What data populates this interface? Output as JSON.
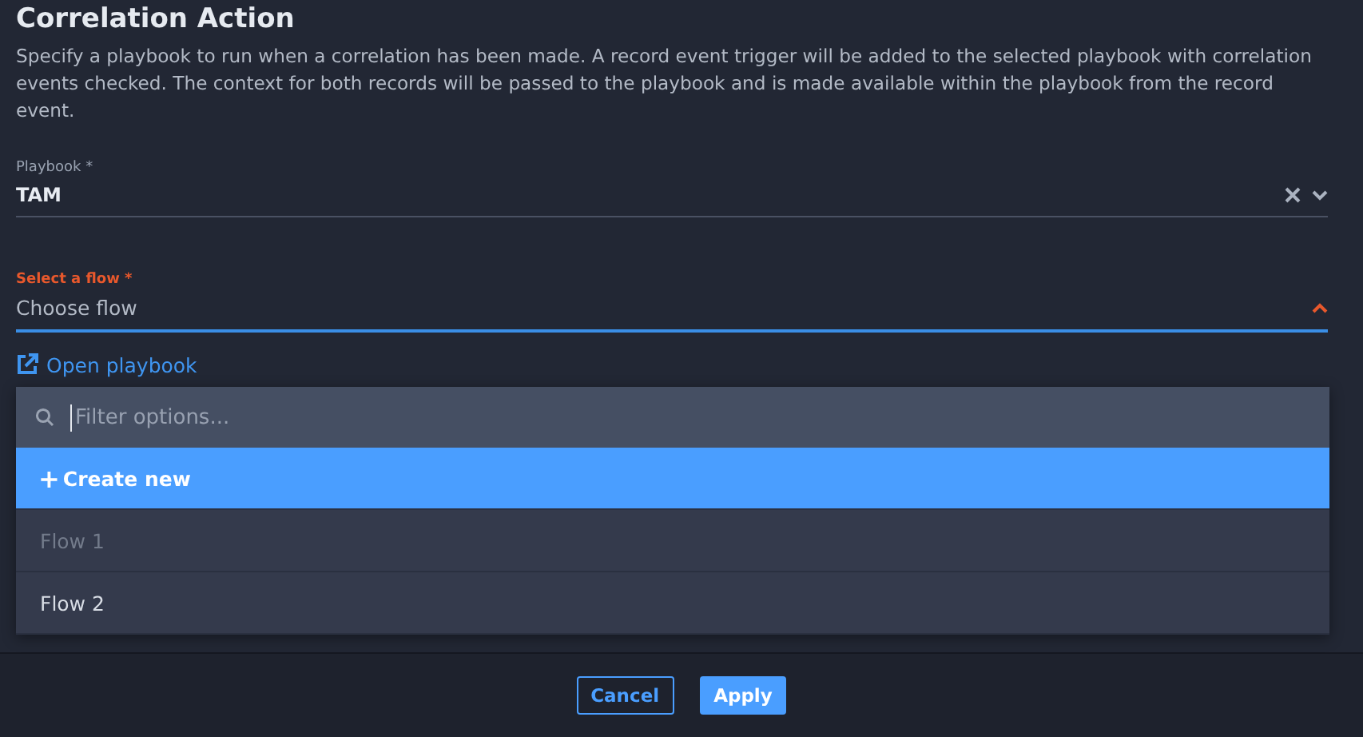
{
  "title": "Correlation Action",
  "description": "Specify a playbook to run when a correlation has been made. A record event trigger will be added to the selected playbook with correlation events checked. The context for both records will be passed to the playbook and is made available within the playbook from the record event.",
  "playbook_field": {
    "label": "Playbook *",
    "value": "TAM",
    "clearable": true
  },
  "flow_field": {
    "label": "Select a flow *",
    "placeholder": "Choose flow",
    "open": true,
    "invalid": true
  },
  "link": {
    "label": "Open playbook"
  },
  "dropdown": {
    "filter_placeholder": "Filter options...",
    "create": {
      "icon": "+",
      "label": "Create new",
      "highlighted": true
    },
    "options": [
      {
        "label": "Flow 1",
        "disabled": true
      },
      {
        "label": "Flow 2",
        "disabled": false
      }
    ]
  },
  "buttons": [
    {
      "label": "Cancel",
      "kind": "secondary"
    },
    {
      "label": "Apply",
      "kind": "primary"
    }
  ]
}
